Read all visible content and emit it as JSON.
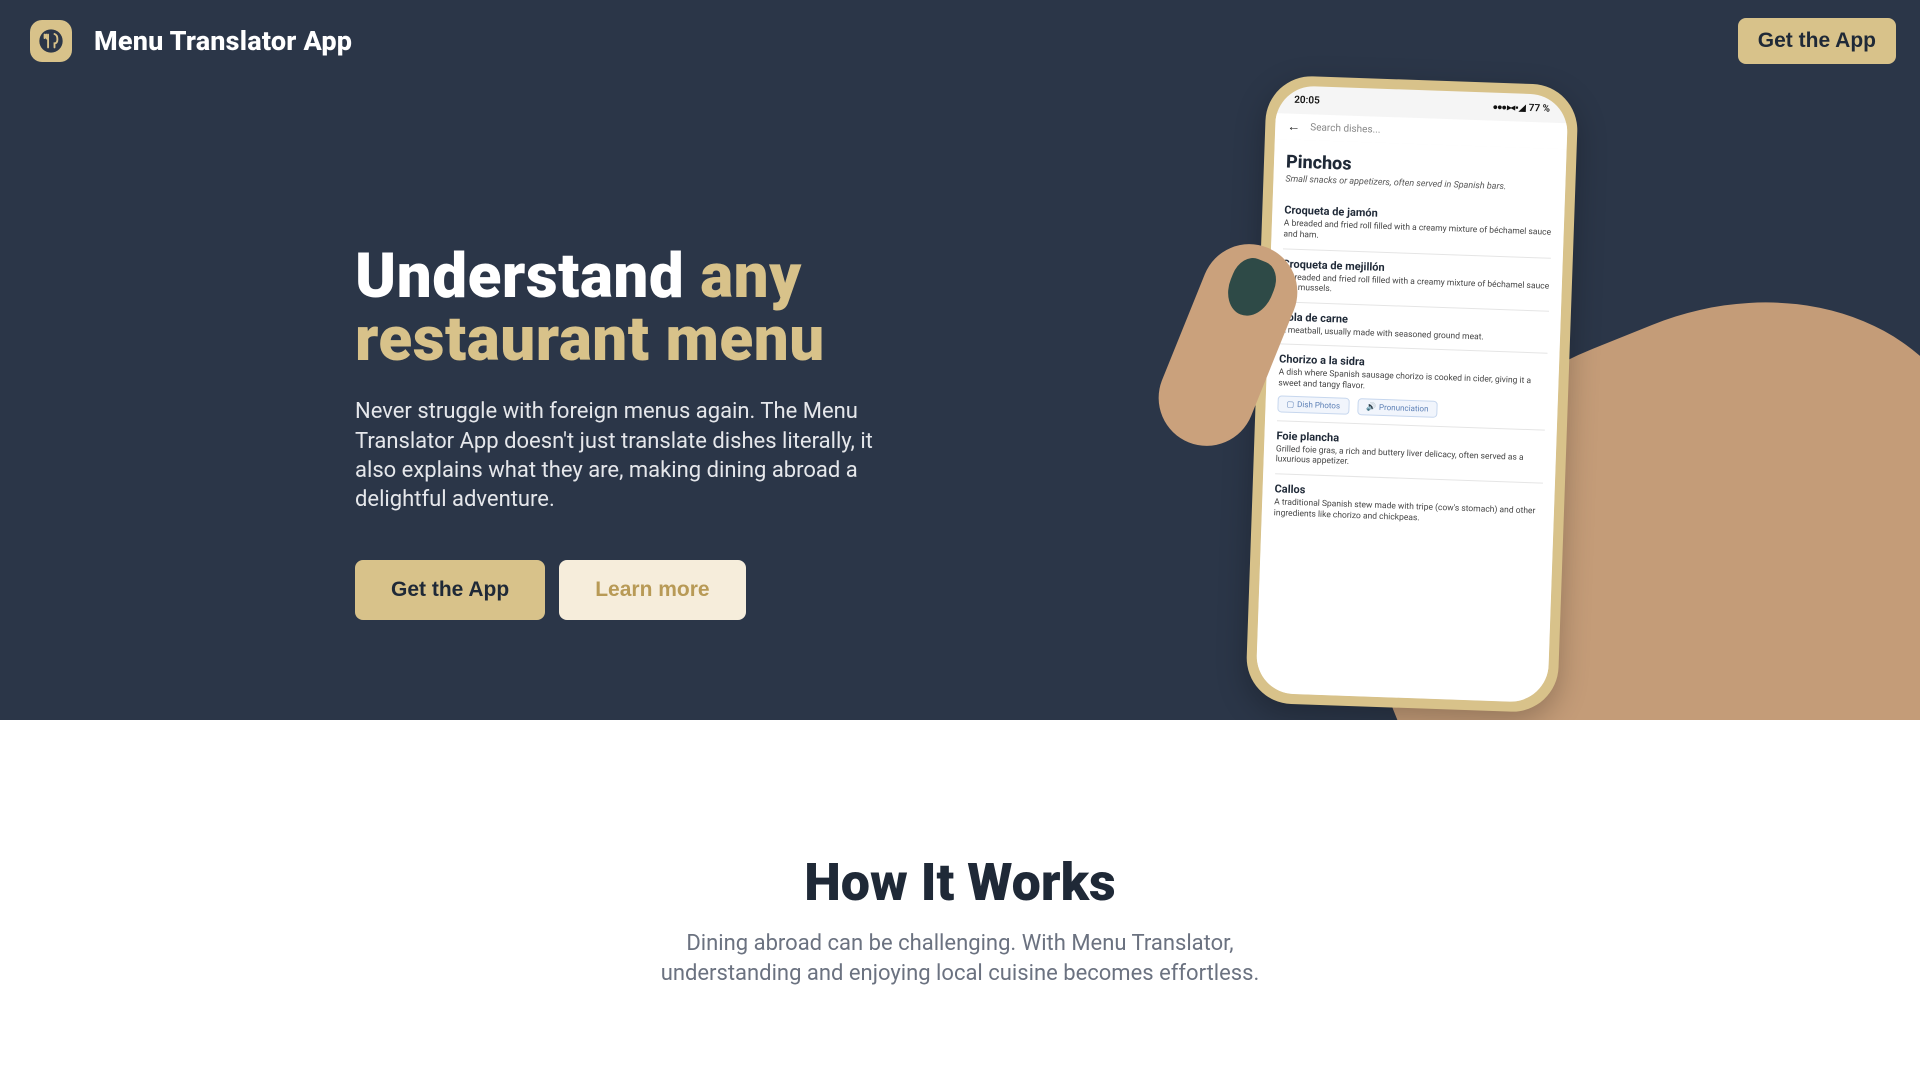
{
  "colors": {
    "accent": "#d8c28a",
    "bg_dark": "#2b3648"
  },
  "header": {
    "brand": "Menu Translator App",
    "cta": "Get the App"
  },
  "hero": {
    "title_lead": "Understand ",
    "title_accent": "any restaurant menu",
    "subtitle": "Never struggle with foreign menus again. The Menu Translator App doesn't just translate dishes literally, it also explains what they are, making dining abroad a delightful adventure.",
    "primary_cta": "Get the App",
    "secondary_cta": "Learn more"
  },
  "phone": {
    "status_time": "20:05",
    "status_battery": "77 %",
    "search_placeholder": "Search dishes...",
    "section_title": "Pinchos",
    "section_subtitle": "Small snacks or appetizers, often served in Spanish bars.",
    "action_photos": "Dish Photos",
    "action_pronounce": "Pronunciation",
    "action_photos_icon": "photo-icon",
    "action_pronounce_icon": "speaker-icon",
    "dishes": [
      {
        "name": "Croqueta de jamón",
        "desc": "A breaded and fried roll filled with a creamy mixture of béchamel sauce and ham.",
        "actions": false
      },
      {
        "name": "Croqueta de mejillón",
        "desc": "A breaded and fried roll filled with a creamy mixture of béchamel sauce and mussels.",
        "actions": false
      },
      {
        "name": "Bola de carne",
        "desc": "A meatball, usually made with seasoned ground meat.",
        "actions": false
      },
      {
        "name": "Chorizo a la sidra",
        "desc": "A dish where Spanish sausage chorizo is cooked in cider, giving it a sweet and tangy flavor.",
        "actions": true
      },
      {
        "name": "Foie plancha",
        "desc": "Grilled foie gras, a rich and buttery liver delicacy, often served as a luxurious appetizer.",
        "actions": false
      },
      {
        "name": "Callos",
        "desc": "A traditional Spanish stew made with tripe (cow's stomach) and other ingredients like chorizo and chickpeas.",
        "actions": false
      }
    ]
  },
  "how": {
    "title": "How It Works",
    "subtitle": "Dining abroad can be challenging. With Menu Translator, understanding and enjoying local cuisine becomes effortless."
  }
}
